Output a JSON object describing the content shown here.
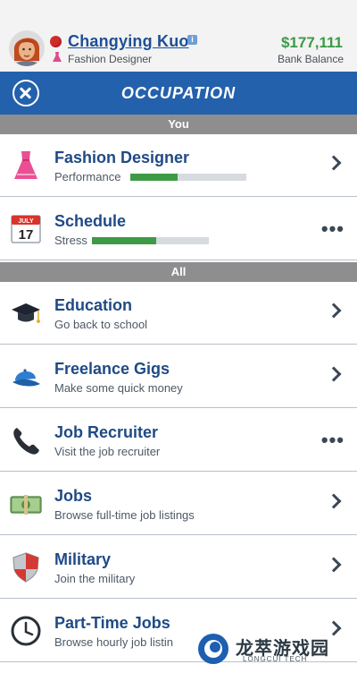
{
  "header": {
    "name": "Changying Kuo",
    "info_badge": "i",
    "job_title": "Fashion Designer",
    "balance": "$177,111",
    "balance_label": "Bank Balance"
  },
  "titlebar": {
    "title": "OCCUPATION"
  },
  "sections": {
    "you": "You",
    "all": "All"
  },
  "you_rows": [
    {
      "title": "Fashion Designer",
      "meter_label": "Performance",
      "meter_value": 0.41,
      "icon": "dress-icon",
      "action": "chevron"
    },
    {
      "title": "Schedule",
      "meter_label": "Stress",
      "meter_value": 0.55,
      "icon": "calendar-icon",
      "calendar_month": "JULY",
      "calendar_day": "17",
      "action": "more"
    }
  ],
  "all_rows": [
    {
      "title": "Education",
      "subtitle": "Go back to school",
      "icon": "graduation-cap-icon",
      "action": "chevron"
    },
    {
      "title": "Freelance Gigs",
      "subtitle": "Make some quick money",
      "icon": "cap-icon",
      "action": "chevron"
    },
    {
      "title": "Job Recruiter",
      "subtitle": "Visit the job recruiter",
      "icon": "phone-icon",
      "action": "more"
    },
    {
      "title": "Jobs",
      "subtitle": "Browse full-time job listings",
      "icon": "money-icon",
      "action": "chevron"
    },
    {
      "title": "Military",
      "subtitle": "Join the military",
      "icon": "shield-icon",
      "action": "chevron"
    },
    {
      "title": "Part-Time Jobs",
      "subtitle": "Browse hourly job listin",
      "icon": "clock-icon",
      "action": "chevron"
    }
  ],
  "more_glyph": "•••",
  "watermark": {
    "text": "龙萃游戏园",
    "sub": "LONGCUI TECH"
  },
  "colors": {
    "brand_blue": "#2461ac",
    "balance_green": "#3c9a46",
    "title_blue": "#1f4a85",
    "section_gray": "#8e8e8e"
  }
}
